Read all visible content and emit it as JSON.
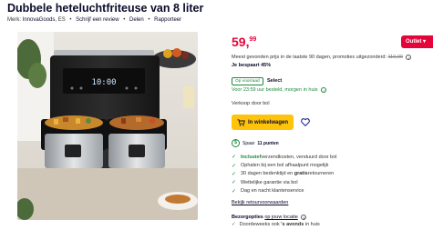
{
  "page": {
    "title": "Dubbele heteluchtfriteuse van 8 liter",
    "meta": {
      "brand_label": "Merk:",
      "brand": "InnovaGoods",
      "brand_suffix": ", ES",
      "review_link": "Schrijf een review",
      "share_link": "Delen",
      "report_link": "Rapporteer",
      "separator": "•"
    }
  },
  "offer": {
    "price_main": "59,",
    "price_cents": "99",
    "outlet_label": "Outlet",
    "lowest_text": "Meest gevonden prijs in de laatste 90 dagen, promoties uitgezonderd:",
    "lowest_price": "110,00",
    "saving": "Je bespaart 45%",
    "stock_badge": "Op voorraad",
    "select_badge": "Select",
    "delivery": "Voor 23:59 uur besteld, morgen in huis",
    "seller": "Verkoop door bol",
    "cart_label": "In winkelwagen",
    "spaar_text": "Spaar",
    "spaar_points": "11 punten"
  },
  "usps": [
    {
      "prefix": "Inclusief",
      "text": " verzendkosten, verstuurd door bol",
      "style": "green"
    },
    {
      "prefix": "",
      "text": "Ophalen bij een bol afhaalpunt mogelijk",
      "style": ""
    },
    {
      "prefix": "",
      "text": "30 dagen bedenktijd en ",
      "suffix": "gratis",
      "suffix2": " retourneren",
      "style": "bold-suffix"
    },
    {
      "prefix": "",
      "text": "Wettelijke garantie via bol",
      "style": ""
    },
    {
      "prefix": "",
      "text": "Dag en nacht klantenservice",
      "style": ""
    }
  ],
  "return_link": "Bekijk retourvoorwaarden",
  "pickup": {
    "title": "Bezorgopties",
    "link": "op jouw locatie",
    "item_prefix": "Doordeweeks ook ",
    "item_bold": "'s avonds",
    "item_suffix": " in huis"
  },
  "image": {
    "display_time": "10:00",
    "accent": "#e5043a",
    "brand_color": "#0a0a2c",
    "green": "#1b8a3d",
    "yellow": "#ffc30a"
  }
}
